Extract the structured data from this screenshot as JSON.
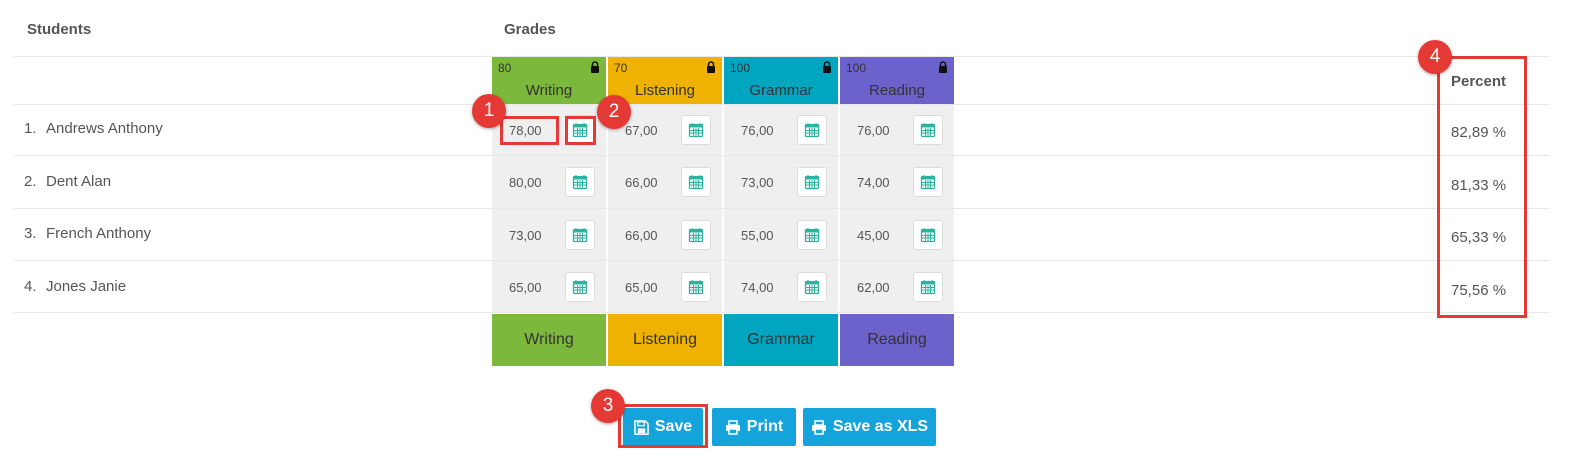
{
  "headers": {
    "students": "Students",
    "grades": "Grades",
    "percent": "Percent"
  },
  "columns": [
    {
      "name": "Writing",
      "max": "80",
      "color": "#7cb83b"
    },
    {
      "name": "Listening",
      "max": "70",
      "color": "#f0b200"
    },
    {
      "name": "Grammar",
      "max": "100",
      "color": "#00a6c0"
    },
    {
      "name": "Reading",
      "max": "100",
      "color": "#6b62cb"
    }
  ],
  "students": [
    {
      "num": "1.",
      "name": "Andrews Anthony",
      "grades": [
        "78,00",
        "67,00",
        "76,00",
        "76,00"
      ],
      "percent": "82,89 %"
    },
    {
      "num": "2.",
      "name": "Dent Alan",
      "grades": [
        "80,00",
        "66,00",
        "73,00",
        "74,00"
      ],
      "percent": "81,33 %"
    },
    {
      "num": "3.",
      "name": "French Anthony",
      "grades": [
        "73,00",
        "66,00",
        "55,00",
        "45,00"
      ],
      "percent": "65,33 %"
    },
    {
      "num": "4.",
      "name": "Jones Janie",
      "grades": [
        "65,00",
        "65,00",
        "74,00",
        "62,00"
      ],
      "percent": "75,56 %"
    }
  ],
  "buttons": {
    "save": "Save",
    "print": "Print",
    "save_xls": "Save as XLS"
  },
  "annotations": [
    "1",
    "2",
    "3",
    "4"
  ],
  "icons": {
    "lock": "lock-icon",
    "calendar": "calendar-icon",
    "save": "floppy-disk-icon",
    "print": "printer-icon"
  },
  "colors": {
    "button": "#15a3dc",
    "highlight": "#e53935",
    "calendar_icon": "#2bb3a0"
  }
}
